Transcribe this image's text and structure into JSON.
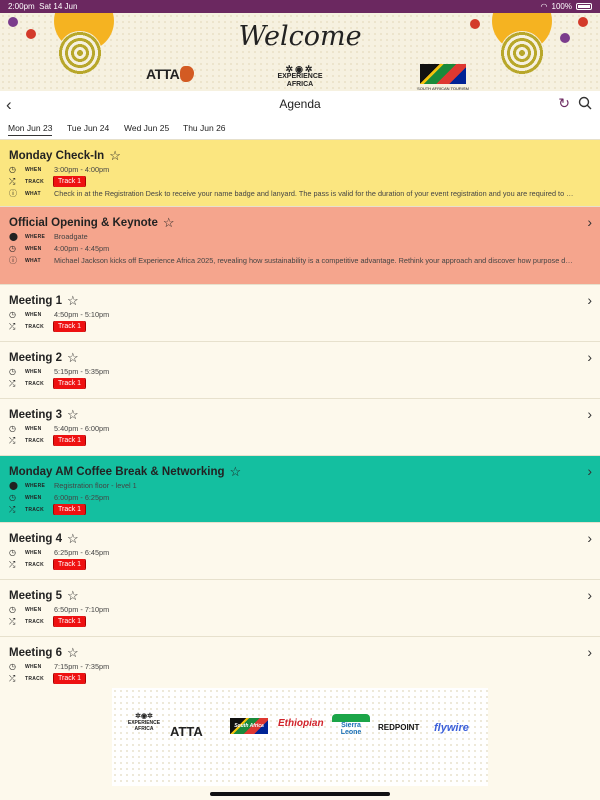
{
  "status": {
    "time": "2:00pm",
    "date": "Sat 14 Jun",
    "battery": "100%"
  },
  "banner": {
    "welcome": "Welcome",
    "logos": {
      "atta": "ATTA",
      "experience": "EXPERIENCE AFRICA",
      "sa": "South Africa",
      "sa_sub": "SOUTH AFRICAN TOURISM"
    }
  },
  "nav": {
    "title": "Agenda"
  },
  "tabs": [
    "Mon Jun 23",
    "Tue Jun 24",
    "Wed Jun 25",
    "Thu Jun 26"
  ],
  "labels": {
    "when": "WHEN",
    "where": "WHERE",
    "track": "TRACK",
    "what": "WHAT"
  },
  "agenda": [
    {
      "title": "Monday Check-In",
      "when": "3:00pm - 4:00pm",
      "track": "Track 1",
      "what": "Check in at the Registration Desk to receive your name badge and lanyard. The pass is valid for the duration of your event registration and you are required to wea..."
    },
    {
      "title": "Official Opening & Keynote",
      "where": "Broadgate",
      "when": "4:00pm - 4:45pm",
      "what": "Michael Jackson kicks off Experience Africa 2025, revealing how sustainability is a competitive advantage. Rethink your approach and discover how purpose driv..."
    },
    {
      "title": "Meeting 1",
      "when": "4:50pm - 5:10pm",
      "track": "Track 1"
    },
    {
      "title": "Meeting 2",
      "when": "5:15pm - 5:35pm",
      "track": "Track 1"
    },
    {
      "title": "Meeting 3",
      "when": "5:40pm - 6:00pm",
      "track": "Track 1"
    },
    {
      "title": "Monday AM Coffee Break & Networking",
      "where": "Registration floor - level 1",
      "when": "6:00pm - 6:25pm",
      "track": "Track 1"
    },
    {
      "title": "Meeting 4",
      "when": "6:25pm - 6:45pm",
      "track": "Track 1"
    },
    {
      "title": "Meeting 5",
      "when": "6:50pm - 7:10pm",
      "track": "Track 1"
    },
    {
      "title": "Meeting 6",
      "when": "7:15pm - 7:35pm",
      "track": "Track 1"
    }
  ],
  "sponsors": [
    "EXPERIENCE AFRICA",
    "ATTA",
    "South Africa",
    "Ethiopian",
    "Sierra Leone",
    "REDPOINT",
    "flywire"
  ],
  "colors": {
    "header": "#6b2860",
    "checkin": "#fbe680",
    "keynote": "#f5a58d",
    "coffee": "#14bfa0",
    "meeting": "#fdf9ec",
    "track": "#ee1111"
  }
}
